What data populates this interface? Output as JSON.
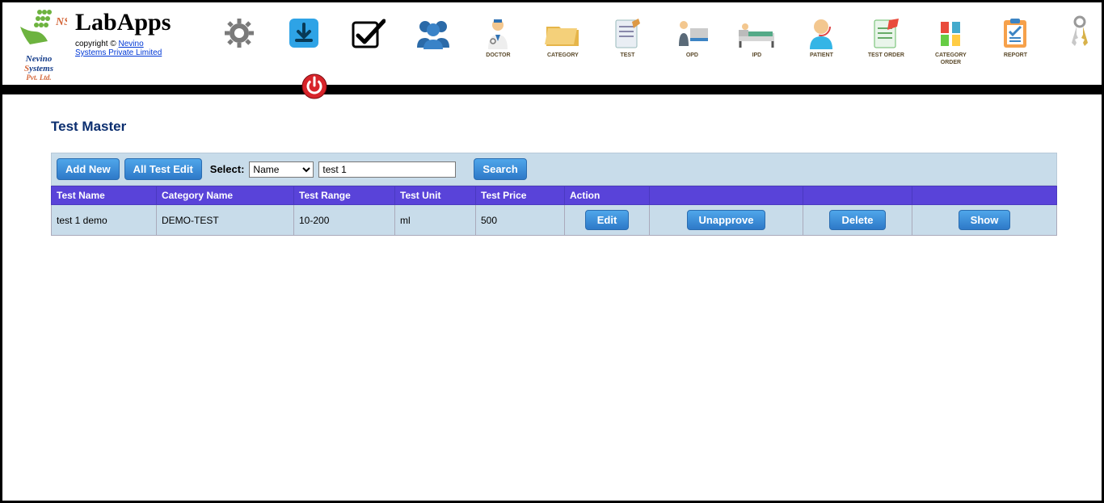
{
  "brand": {
    "app_name": "LabApps",
    "copyright_prefix": "copyright © ",
    "copyright_link": "Nevino Systems Private Limited",
    "logo_text_top": "NS",
    "logo_text_bottom": "Nevino Systems",
    "logo_text_sub": "Pvt. Ltd."
  },
  "nav": {
    "items": [
      {
        "name": "settings-icon",
        "label": ""
      },
      {
        "name": "download-icon",
        "label": ""
      },
      {
        "name": "check-icon",
        "label": ""
      },
      {
        "name": "people-icon",
        "label": ""
      },
      {
        "name": "doctor-icon",
        "label": "DOCTOR"
      },
      {
        "name": "category-icon",
        "label": "CATEGORY"
      },
      {
        "name": "test-icon",
        "label": "TEST"
      },
      {
        "name": "opd-icon",
        "label": "OPD"
      },
      {
        "name": "ipd-icon",
        "label": "IPD"
      },
      {
        "name": "patient-icon",
        "label": "PATIENT"
      },
      {
        "name": "testorder-icon",
        "label": "TEST ORDER"
      },
      {
        "name": "categoryorder-icon",
        "label": "CATEGORY ORDER"
      },
      {
        "name": "report-icon",
        "label": "REPORT"
      },
      {
        "name": "keys-icon",
        "label": ""
      }
    ]
  },
  "page": {
    "title": "Test Master"
  },
  "toolbar": {
    "add_new": "Add New",
    "all_test_edit": "All Test Edit",
    "select_label": "Select:",
    "select_value": "Name",
    "search_value": "test 1",
    "search_btn": "Search"
  },
  "table": {
    "headers": [
      "Test Name",
      "Category Name",
      "Test Range",
      "Test Unit",
      "Test Price",
      "Action",
      "",
      "",
      ""
    ],
    "rows": [
      {
        "test_name": "test 1 demo",
        "category": "DEMO-TEST",
        "range": "10-200",
        "unit": "ml",
        "price": "500",
        "edit": "Edit",
        "unapprove": "Unapprove",
        "delete": "Delete",
        "show": "Show"
      }
    ]
  }
}
